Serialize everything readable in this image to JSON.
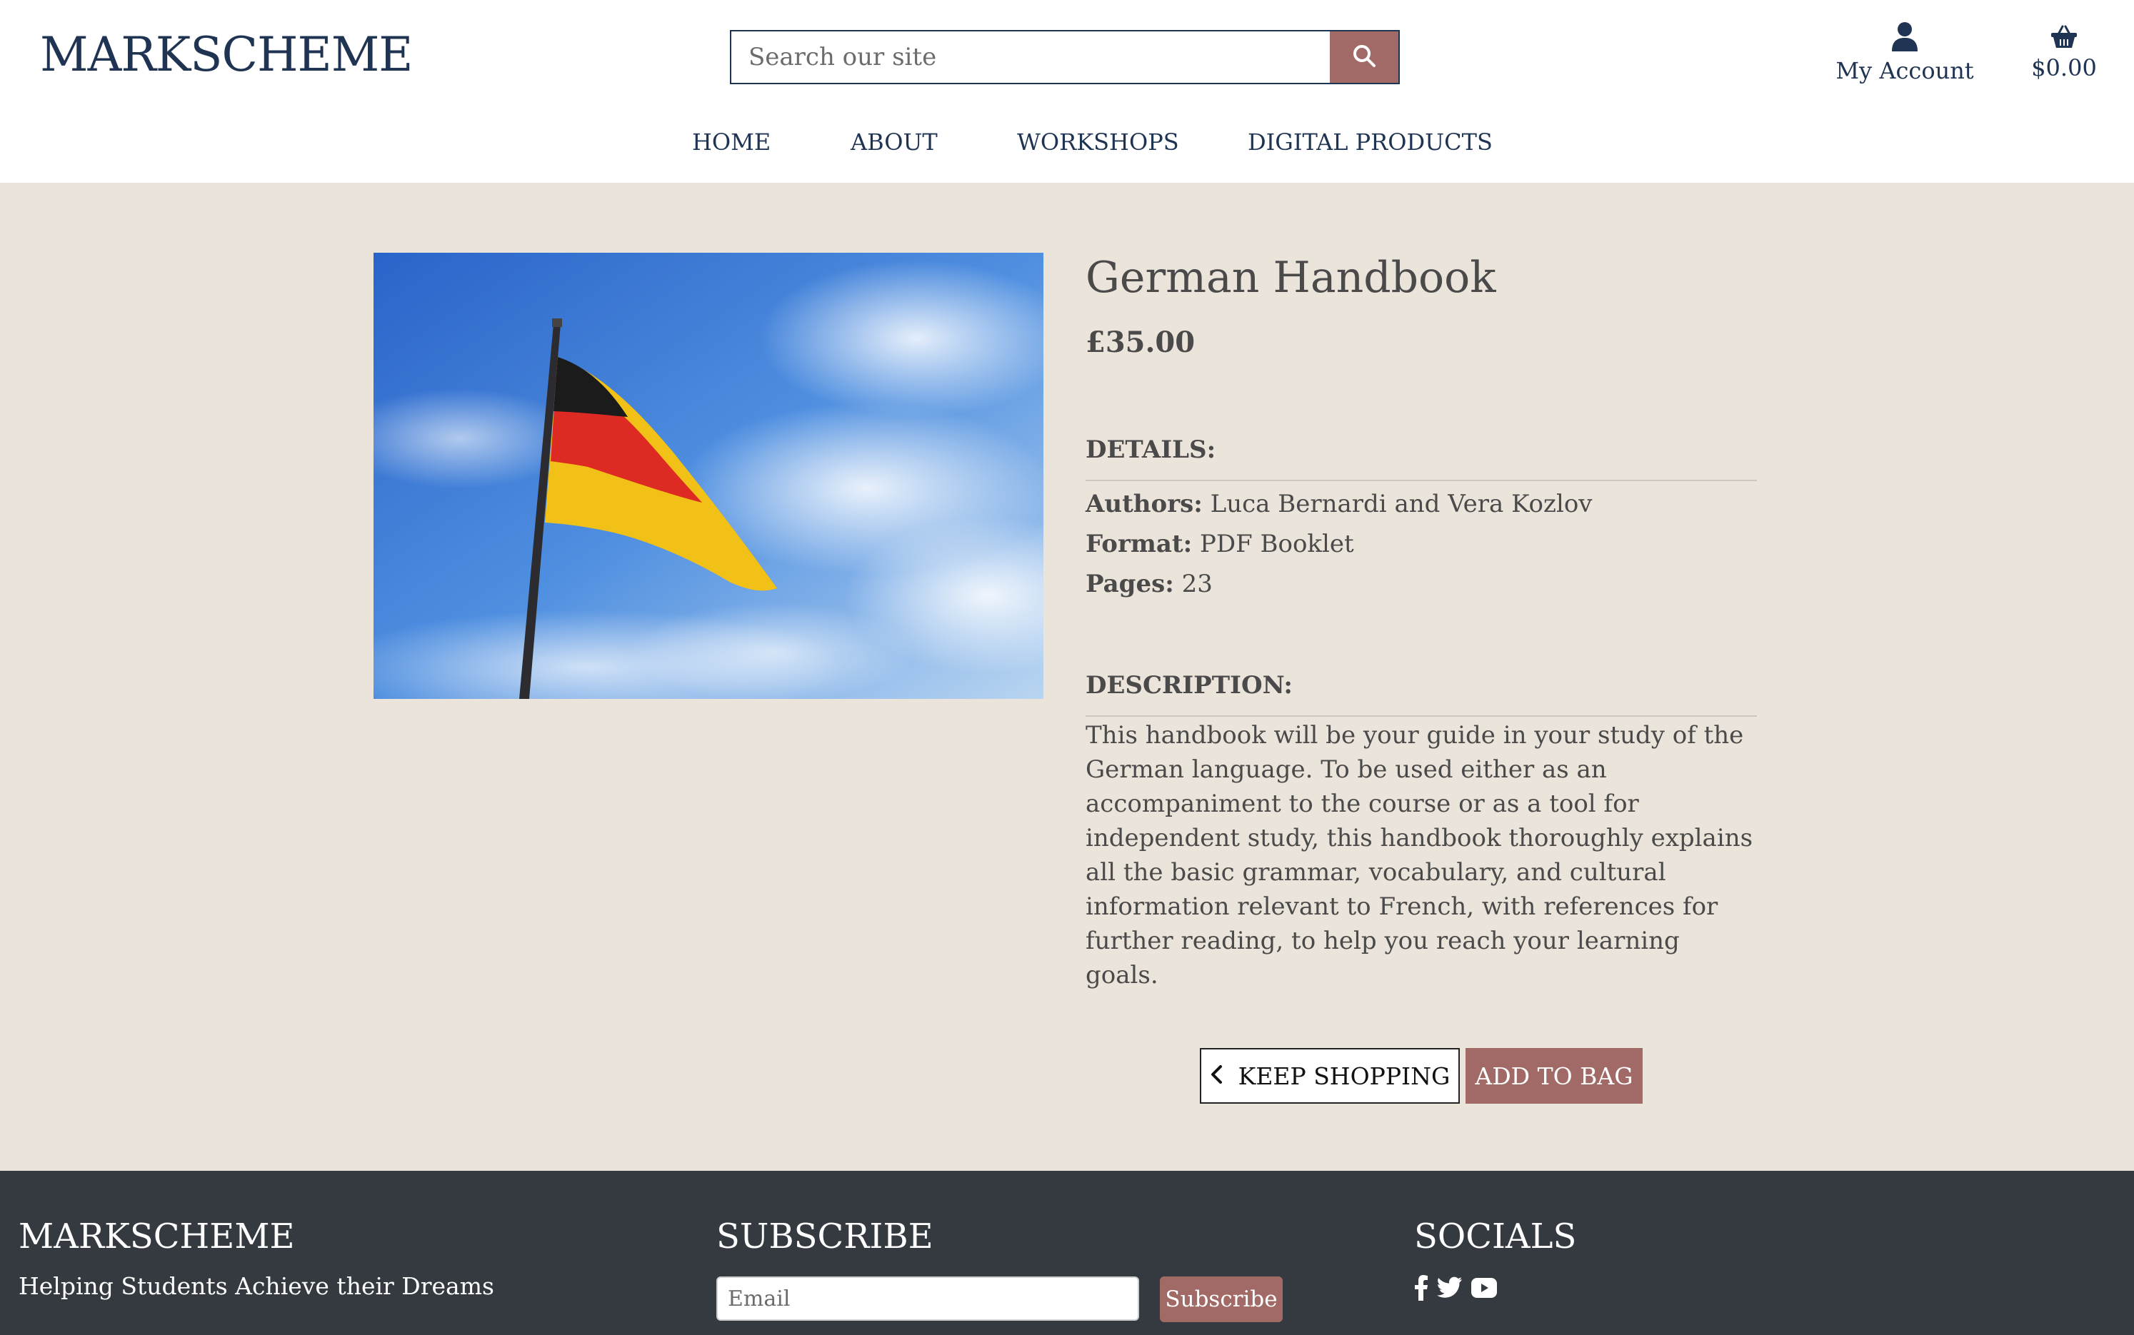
{
  "header": {
    "logo": "MARKSCHEME",
    "search": {
      "placeholder": "Search our site",
      "value": ""
    },
    "account_label": "My Account",
    "bag_total": "$0.00"
  },
  "nav": {
    "items": [
      {
        "label": "HOME"
      },
      {
        "label": "ABOUT"
      },
      {
        "label": "WORKSHOPS"
      },
      {
        "label": "DIGITAL PRODUCTS"
      }
    ]
  },
  "product": {
    "image_icon": "german-flag-image",
    "title": "German Handbook",
    "price": "£35.00",
    "details_heading": "DETAILS:",
    "details": [
      {
        "label": "Authors:",
        "value": "Luca Bernardi and Vera Kozlov"
      },
      {
        "label": "Format:",
        "value": "PDF Booklet"
      },
      {
        "label": "Pages:",
        "value": "23"
      }
    ],
    "description_heading": "DESCRIPTION:",
    "description": "This handbook will be your guide in your study of the German language. To be used either as an accompaniment to the course or as a tool for independent study, this handbook thoroughly explains all the basic grammar, vocabulary, and cultural information relevant to French, with references for further reading, to help you reach your learning goals.",
    "keep_shopping_label": "KEEP SHOPPING",
    "add_to_bag_label": "ADD TO BAG"
  },
  "footer": {
    "brand": "MARKSCHEME",
    "tagline": "Helping Students Achieve their Dreams",
    "subscribe_heading": "SUBSCRIBE",
    "email_placeholder": "Email",
    "subscribe_button": "Subscribe",
    "socials_heading": "SOCIALS",
    "social_icons": [
      "facebook-icon",
      "twitter-icon",
      "youtube-icon"
    ]
  },
  "colors": {
    "brand_navy": "#1f3352",
    "accent": "#a16a66",
    "page_bg": "#ebe4da",
    "footer_bg": "#343a40"
  }
}
